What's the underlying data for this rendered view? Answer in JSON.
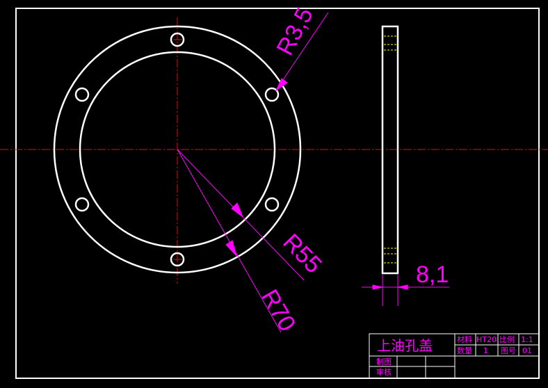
{
  "drawing": {
    "dimensions": {
      "hole_radius": "R3,5",
      "inner_radius": "R55",
      "outer_radius": "R70",
      "thickness": "8,1"
    },
    "title_block": {
      "part_name": "上油孔盖",
      "material_label": "材料",
      "material_value": "HT20",
      "scale_label": "比例",
      "scale_value": "1:1",
      "quantity_label": "数量",
      "quantity_value": "1",
      "drawing_no_label": "图号",
      "drawing_no_value": "01",
      "drawn_label": "制图",
      "checked_label": "审核"
    },
    "colors": {
      "background": "#000000",
      "outline": "#ffffff",
      "center_line": "#ff0000",
      "dimension": "#ff00ff",
      "hidden_line": "#ffff00"
    }
  }
}
